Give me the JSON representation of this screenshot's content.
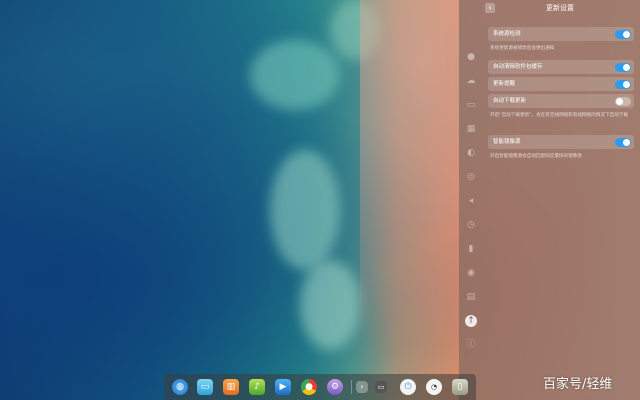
{
  "settings": {
    "title": "更新设置",
    "rows": [
      {
        "label": "系统源检测",
        "state": "on"
      },
      {
        "label": "自动清除软件包缓存",
        "state": "on"
      },
      {
        "label": "更新提醒",
        "state": "on"
      },
      {
        "label": "自动下载更新",
        "state": "off"
      },
      {
        "label": "智能镜像源",
        "state": "on"
      }
    ],
    "desc_1": "系统更新源被修改后会弹出通知",
    "desc_2": "开启“自动下载更新”，会在有无线网络和有线网络的情况下自动下载",
    "desc_3": "开启智能镜像源会自动匹配响应最快的镜像源"
  },
  "watermark": "百家号/轻维",
  "colors": {
    "toggle_on": "#2c9cf0"
  },
  "sidebar_icons": [
    "account-icon",
    "cloud-icon",
    "display-icon",
    "calendar-icon",
    "personalization-icon",
    "network-icon",
    "sound-icon",
    "time-icon",
    "power-icon",
    "mouse-icon",
    "keyboard-icon",
    "update-icon",
    "info-icon"
  ],
  "dock_icons": [
    "launcher-icon",
    "file-manager-icon",
    "app-store-icon",
    "music-icon",
    "video-icon",
    "chrome-icon",
    "settings-icon",
    "arrow-icon",
    "terminal-icon",
    "power-icon",
    "network-monitor-icon",
    "trash-icon"
  ]
}
